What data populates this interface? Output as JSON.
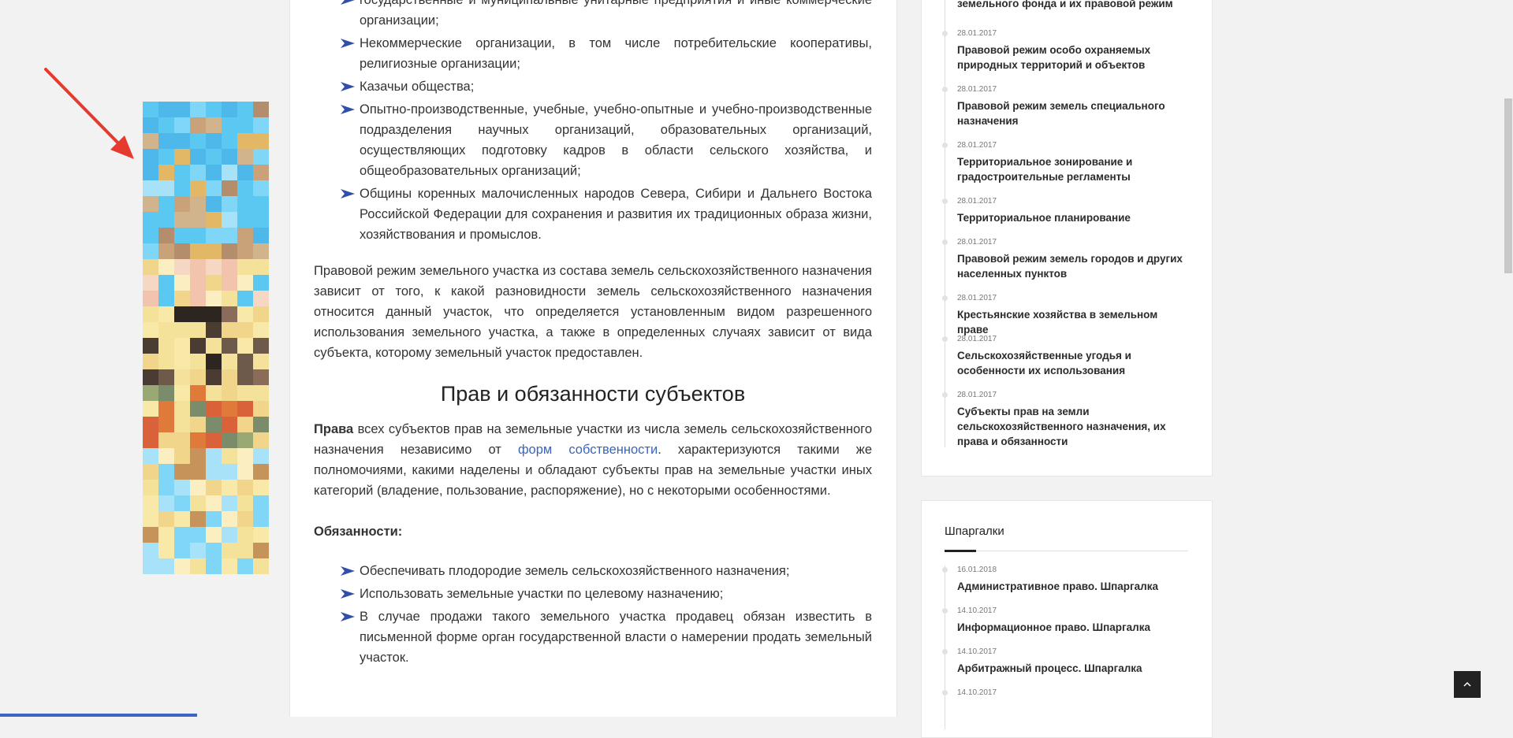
{
  "article": {
    "top_list": [
      "государственные и муниципальные унитарные предприятия и иные коммерческие организации;",
      "Некоммерческие организации, в том числе потребительские кооперативы, религиозные организации;",
      "Казачьи общества;",
      "Опытно-производственные, учебные, учебно-опытные и учебно-производственные подразделения научных организаций, образовательных организаций, осуществляющих подготовку кадров в области сельского хозяйства, и общеобразовательных организаций;",
      "Общины коренных малочисленных народов Севера, Сибири и Дальнего Востока Российской Федерации для сохранения и развития их традиционных образа жизни, хозяйствования и промыслов."
    ],
    "paragraph_1": "Правовой режим земельного участка из состава земель сельскохозяйственного назначения зависит от того, к какой разновидности земель сельскохозяйственного назначения относится данный участок, что определяется установленным видом разрешенного использования земельного участка, а также в определенных случаях зависит от вида субъекта, которому земельный участок предоставлен.",
    "heading": "Прав и обязанности субъектов",
    "rights_bold": "Права",
    "rights_text_1": " всех субъектов прав на земельные участки из числа земель сельскохозяйственного назначения независимо от ",
    "rights_link": "форм собственности",
    "rights_text_2": ". характеризуются такими же полномочиями, какими наделены и обладают субъекты прав на земельные участки иных категорий (владение, пользование, распоряжение), но с некоторыми особенностями.",
    "duties_title": "Обязанности:",
    "duties_list": [
      "Обеспечивать плодородие земель сельскохозяйственного назначения;",
      "Использовать земельные участки по целевому назначению;",
      "В случае продажи такого земельного участка продавец обязан известить в письменной форме орган государственной власти о намерении продать земельный участок."
    ]
  },
  "sidebar": {
    "widget_1": {
      "items": [
        {
          "date": "",
          "title": "земельного фонда и их правовой режим"
        },
        {
          "date": "28.01.2017",
          "title": "Правовой режим особо охраняемых природных территорий и объектов"
        },
        {
          "date": "28.01.2017",
          "title": "Правовой режим земель специального назначения"
        },
        {
          "date": "28.01.2017",
          "title": "Территориальное зонирование и градостроительные регламенты"
        },
        {
          "date": "28.01.2017",
          "title": "Территориальное планирование"
        },
        {
          "date": "28.01.2017",
          "title": "Правовой режим земель городов и других населенных пунктов"
        },
        {
          "date": "28.01.2017",
          "title": "Крестьянские хозяйства в земельном праве"
        },
        {
          "date": "28.01.2017",
          "title": "Сельскохозяйственные угодья и особенности их использования"
        },
        {
          "date": "28.01.2017",
          "title": "Субъекты прав на земли сельскохозяйственного назначения, их права и обязанности"
        }
      ]
    },
    "widget_2": {
      "title": "Шпаргалки",
      "items": [
        {
          "date": "16.01.2018",
          "title": "Административное право. Шпаргалка"
        },
        {
          "date": "14.10.2017",
          "title": "Информационное право. Шпаргалка"
        },
        {
          "date": "14.10.2017",
          "title": "Арбитражный процесс. Шпаргалка"
        },
        {
          "date": "14.10.2017",
          "title": ""
        }
      ]
    }
  },
  "colors": {
    "link": "#3a65b7",
    "bullet": "#2f4fa8",
    "arrow": "#e53b2f",
    "progress": "#3f63c6"
  },
  "icons": {
    "bullet": "arrow-bullet-icon",
    "scroll_top": "chevron-up-icon",
    "ad_pointer": "red-arrow-icon"
  }
}
